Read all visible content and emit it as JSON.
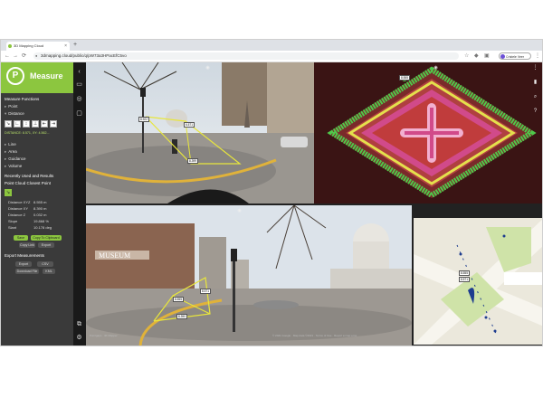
{
  "browser": {
    "tab_title": "3D Mapping Cloud",
    "url": "3dmapping.cloud/public/q/pW73a3HPacEfC5vo",
    "profile_label": "Cristele Veer",
    "new_tab": "+",
    "tab_close": "×"
  },
  "sidebar": {
    "brand_title": "Measure",
    "logo_glyph": "P",
    "section_functions": "Measure Functions",
    "functions": [
      {
        "label": "Point"
      },
      {
        "label": "Distance"
      }
    ],
    "tool_buttons": [
      "↘",
      "∟",
      "↕",
      "⊥",
      "⇤",
      "⇥"
    ],
    "coordinates": "DISTANCE: 8.571, XY: 4.562...",
    "more_functions": [
      {
        "label": "Line"
      },
      {
        "label": "Area"
      },
      {
        "label": "Guidance"
      },
      {
        "label": "Volume"
      }
    ],
    "section_recent": "Recently Used and Results",
    "section_point": "Point Cloud Closest Point",
    "measurements": [
      {
        "label": "Distance XYZ",
        "value": "8.555 m"
      },
      {
        "label": "Distance XY",
        "value": "8.390 m"
      },
      {
        "label": "Distance Z",
        "value": "0.032 m"
      },
      {
        "label": "Slope",
        "value": "19.868 %"
      },
      {
        "label": "Slant",
        "value": "10.178 deg"
      }
    ],
    "btn_save": "Save",
    "btn_copy": "Copy To Clipboard",
    "btn_sub1": "Copy Link",
    "btn_sub2": "Export",
    "section_export": "Export Measurements",
    "btn_export1": "Export",
    "btn_export2": "CSV",
    "btn_export3": "Download File",
    "btn_export4": "KML"
  },
  "panels": {
    "view1_labels": [
      "8.922",
      "6.571",
      "8.399"
    ],
    "view2_label": "8.555",
    "view3_labels": [
      "8.555",
      "8.571",
      "8.390"
    ],
    "map_labels": [
      "8.555",
      "8.571"
    ]
  },
  "footer": {
    "left": "Pointgaps · 4K Mapper",
    "right": "© 2021 Google · Map data ©2021 · Terms of Use · Report a map error"
  },
  "icons": {
    "back": "←",
    "forward": "→",
    "reload": "⟳",
    "lock": "🔒",
    "star": "☆",
    "ext": "⋮"
  },
  "colors": {
    "brand": "#8cc63f",
    "measure_line": "#e8e63c",
    "sidebar_bg": "#3a3a3a"
  }
}
